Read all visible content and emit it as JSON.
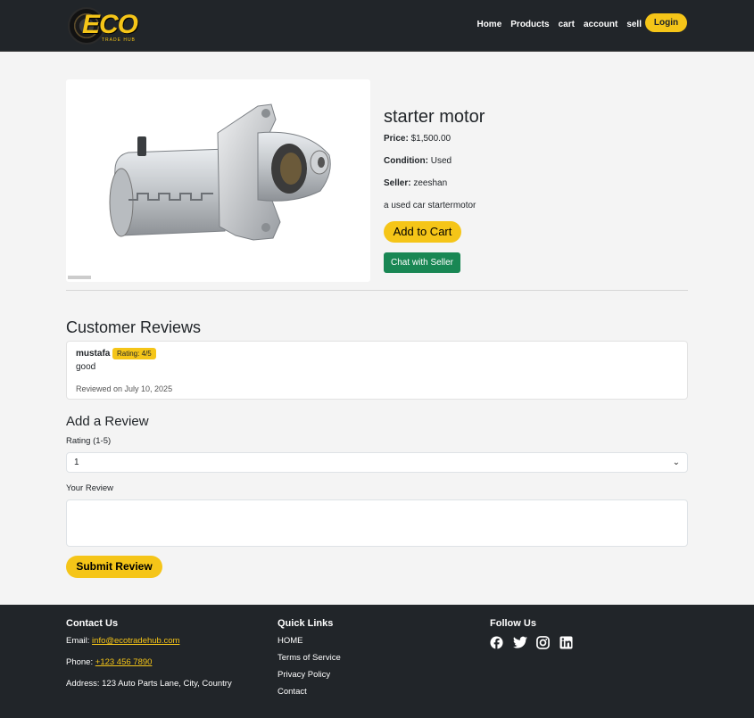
{
  "header": {
    "logo_text": "ECO",
    "logo_sub": "TRADE HUB",
    "nav": [
      "Home",
      "Products",
      "cart",
      "account",
      "sell"
    ],
    "login_label": "Login"
  },
  "product": {
    "title": "starter motor",
    "price_label": "Price:",
    "price": "$1,500.00",
    "condition_label": "Condition:",
    "condition": "Used",
    "seller_label": "Seller:",
    "seller": "zeeshan",
    "description": "a used car startermotor",
    "add_to_cart": "Add to Cart",
    "chat_with_seller": "Chat with Seller"
  },
  "reviews": {
    "title": "Customer Reviews",
    "items": [
      {
        "reviewer": "mustafa",
        "rating": "Rating: 4/5",
        "text": "good",
        "date": "Reviewed on July 10, 2025"
      }
    ]
  },
  "add_review": {
    "title": "Add a Review",
    "rating_label": "Rating (1-5)",
    "rating_value": "1",
    "review_label": "Your Review",
    "submit_label": "Submit Review"
  },
  "footer": {
    "contact_title": "Contact Us",
    "email_label": "Email:",
    "email": "info@ecotradehub.com",
    "phone_label": "Phone:",
    "phone": "+123 456 7890",
    "address": "Address: 123 Auto Parts Lane, City, Country",
    "quick_links_title": "Quick Links",
    "quick_links": [
      "HOME",
      "Terms of Service",
      "Privacy Policy",
      "Contact"
    ],
    "follow_title": "Follow Us",
    "social_icons": [
      "facebook-icon",
      "twitter-icon",
      "instagram-icon",
      "linkedin-icon"
    ]
  },
  "colors": {
    "accent": "#f5c518",
    "dark": "#212529",
    "chat_green": "#198754"
  }
}
